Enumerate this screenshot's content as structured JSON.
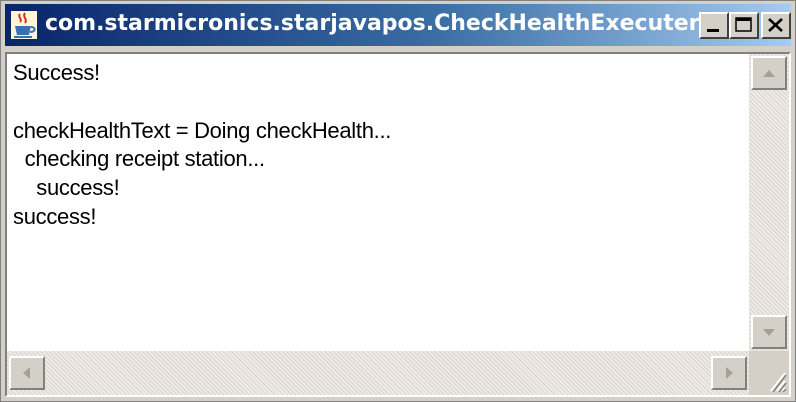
{
  "window": {
    "title": "com.starmicronics.starjavapos.CheckHealthExecuter",
    "app_icon": "java-cup-icon",
    "controls": {
      "minimize": "minimize-icon",
      "maximize": "maximize-icon",
      "close": "close-icon"
    }
  },
  "output": {
    "lines": [
      "Success!",
      "",
      "checkHealthText = Doing checkHealth...",
      "  checking receipt station...",
      "    success!",
      "success!"
    ]
  },
  "colors": {
    "titlebar_start": "#0a246a",
    "titlebar_end": "#a6caf0",
    "window_face": "#d4d0c8",
    "text": "#000000"
  }
}
